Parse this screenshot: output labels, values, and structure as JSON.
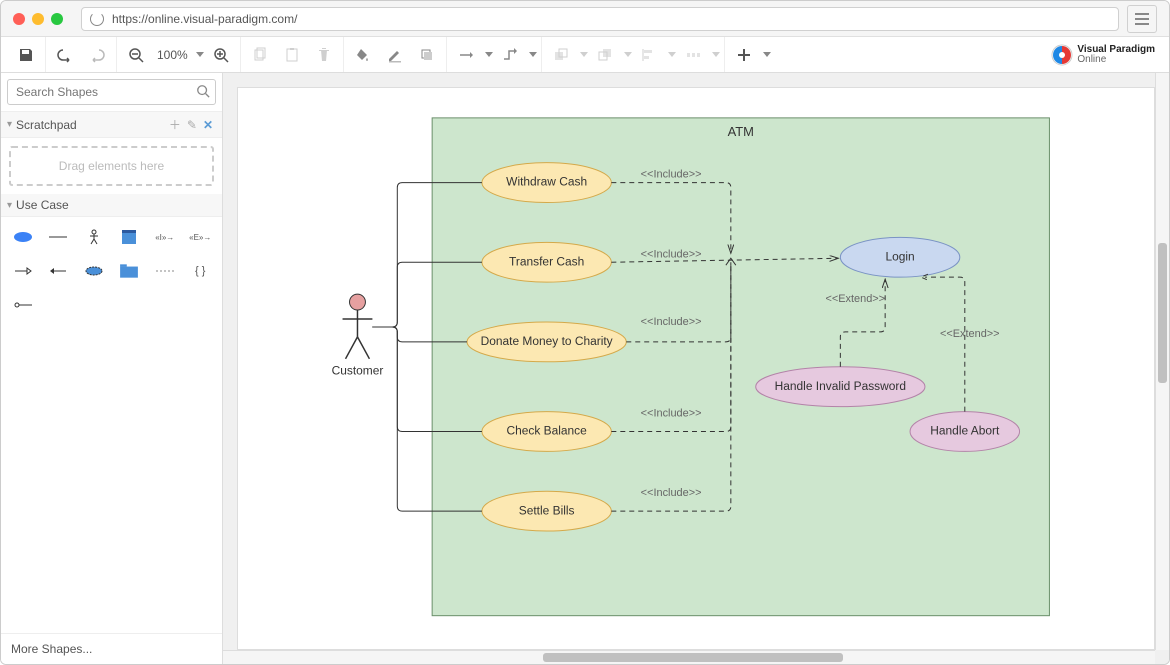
{
  "browser": {
    "url": "https://online.visual-paradigm.com/"
  },
  "toolbar": {
    "zoom": "100%"
  },
  "logo": {
    "line1": "Visual Paradigm",
    "line2": "Online"
  },
  "sidebar": {
    "search_placeholder": "Search Shapes",
    "scratchpad_title": "Scratchpad",
    "scratchpad_hint": "Drag elements here",
    "usecase_panel_title": "Use Case",
    "more_shapes": "More Shapes..."
  },
  "diagram": {
    "system": "ATM",
    "actor": "Customer",
    "usecases": {
      "withdraw": "Withdraw Cash",
      "transfer": "Transfer Cash",
      "donate": "Donate Money to Charity",
      "check": "Check Balance",
      "settle": "Settle Bills",
      "login": "Login",
      "invalid": "Handle Invalid Password",
      "abort": "Handle Abort"
    },
    "stereotypes": {
      "include": "<<Include>>",
      "extend": "<<Extend>>"
    }
  }
}
